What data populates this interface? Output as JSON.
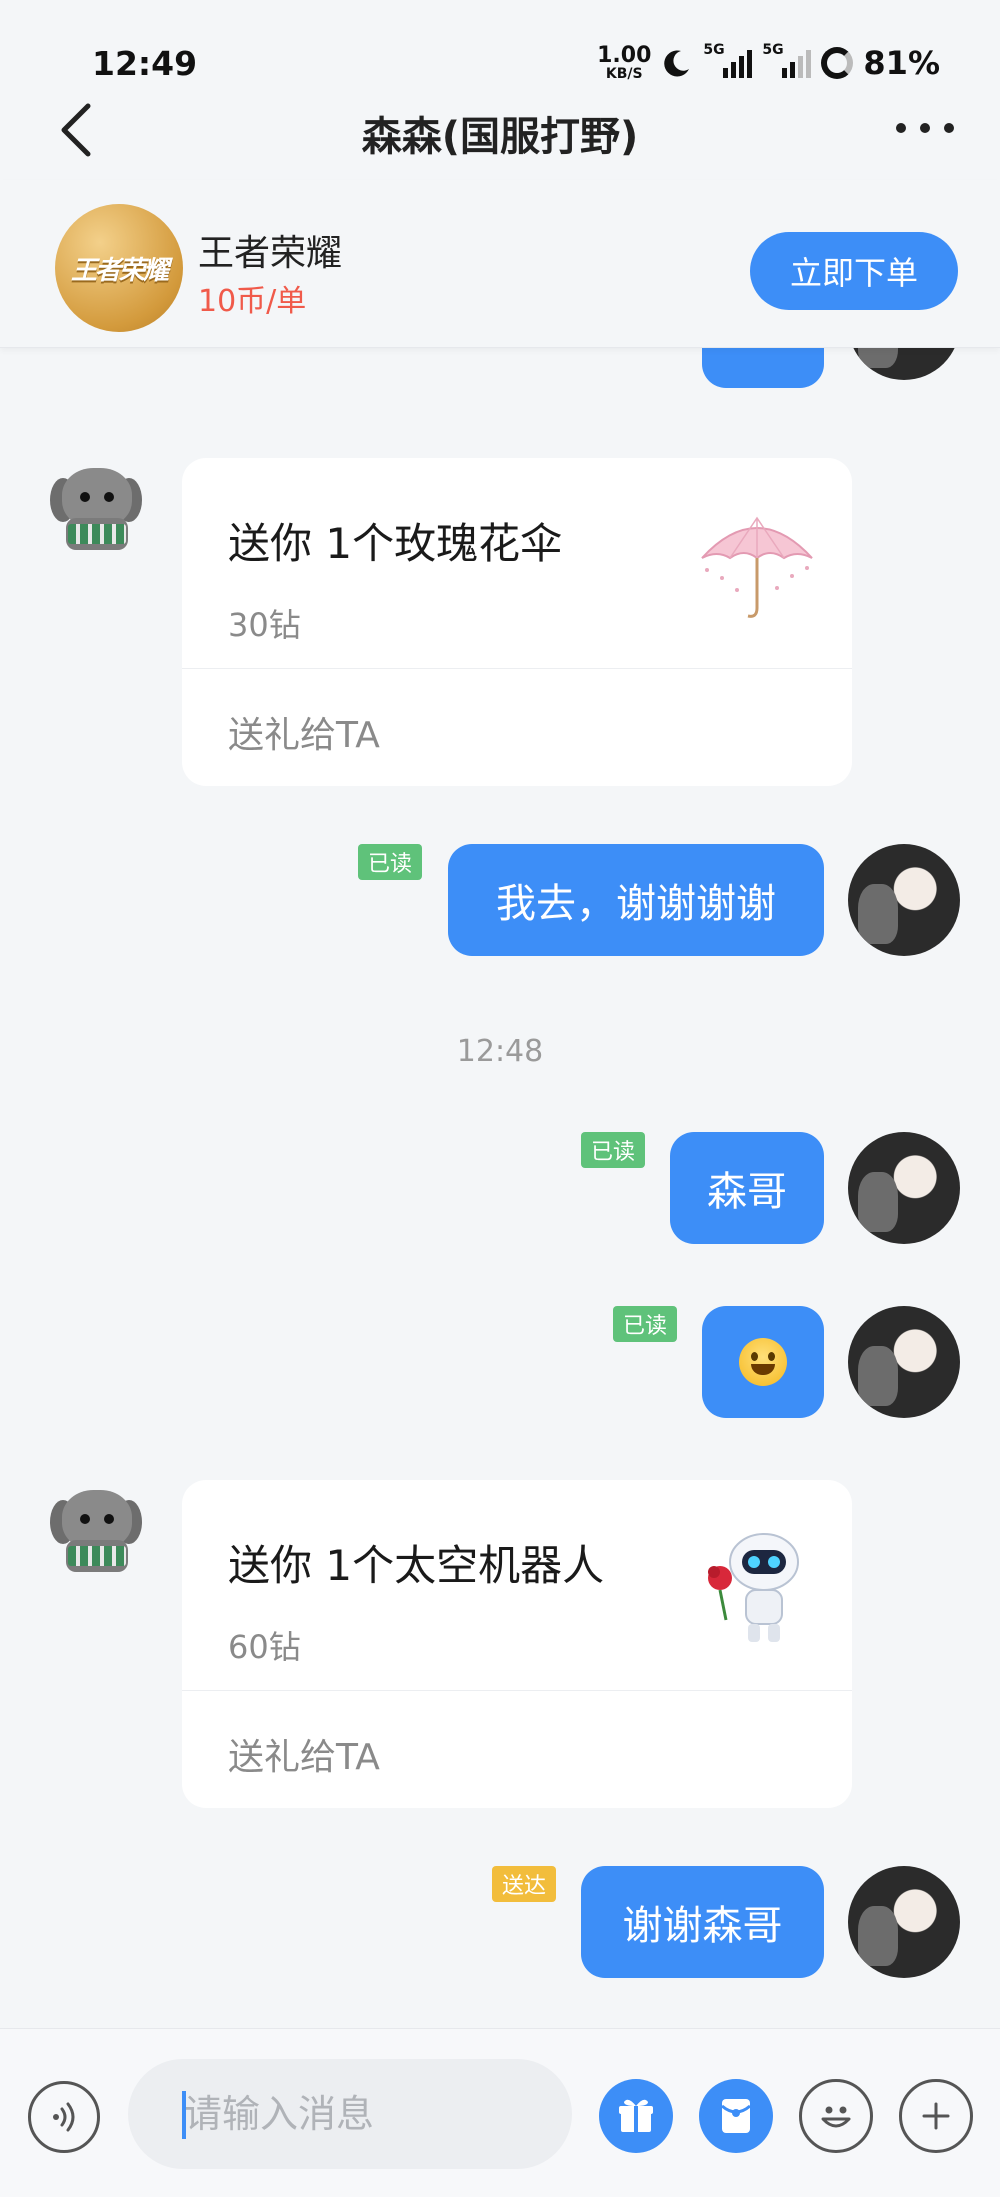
{
  "status_bar": {
    "time": "12:49",
    "net_speed_value": "1.00",
    "net_speed_unit": "KB/S",
    "signal_label_1": "5G",
    "signal_label_2": "5G",
    "battery": "81%"
  },
  "nav": {
    "title": "森森(国服打野)"
  },
  "game_bar": {
    "logo_text": "王者荣耀",
    "name": "王者荣耀",
    "price": "10币/单",
    "order_button": "立即下单"
  },
  "messages": [
    {
      "type": "gift",
      "title": "送你 1个玫瑰花伞",
      "cost": "30钻",
      "action": "送礼给TA",
      "icon": "rose-umbrella-icon"
    },
    {
      "type": "text",
      "from": "self",
      "status": "已读",
      "text": "我去，谢谢谢谢"
    },
    {
      "type": "time",
      "text": "12:48"
    },
    {
      "type": "text",
      "from": "self",
      "status": "已读",
      "text": "森哥"
    },
    {
      "type": "emoji",
      "from": "self",
      "status": "已读",
      "emoji": "grinning-face-emoji"
    },
    {
      "type": "gift",
      "title": "送你 1个太空机器人",
      "cost": "60钻",
      "action": "送礼给TA",
      "icon": "space-robot-icon"
    },
    {
      "type": "text",
      "from": "self",
      "status": "送达",
      "text": "谢谢森哥"
    }
  ],
  "input_bar": {
    "placeholder": "请输入消息",
    "icons": [
      "voice-icon",
      "gift-icon",
      "red-packet-icon",
      "emoji-icon",
      "plus-icon"
    ]
  },
  "colors": {
    "accent_blue": "#3d8ef7",
    "read_badge": "#5fc27a",
    "sent_badge": "#f2bd3c",
    "price_red": "#f05a4a",
    "background": "#f4f6f8"
  }
}
